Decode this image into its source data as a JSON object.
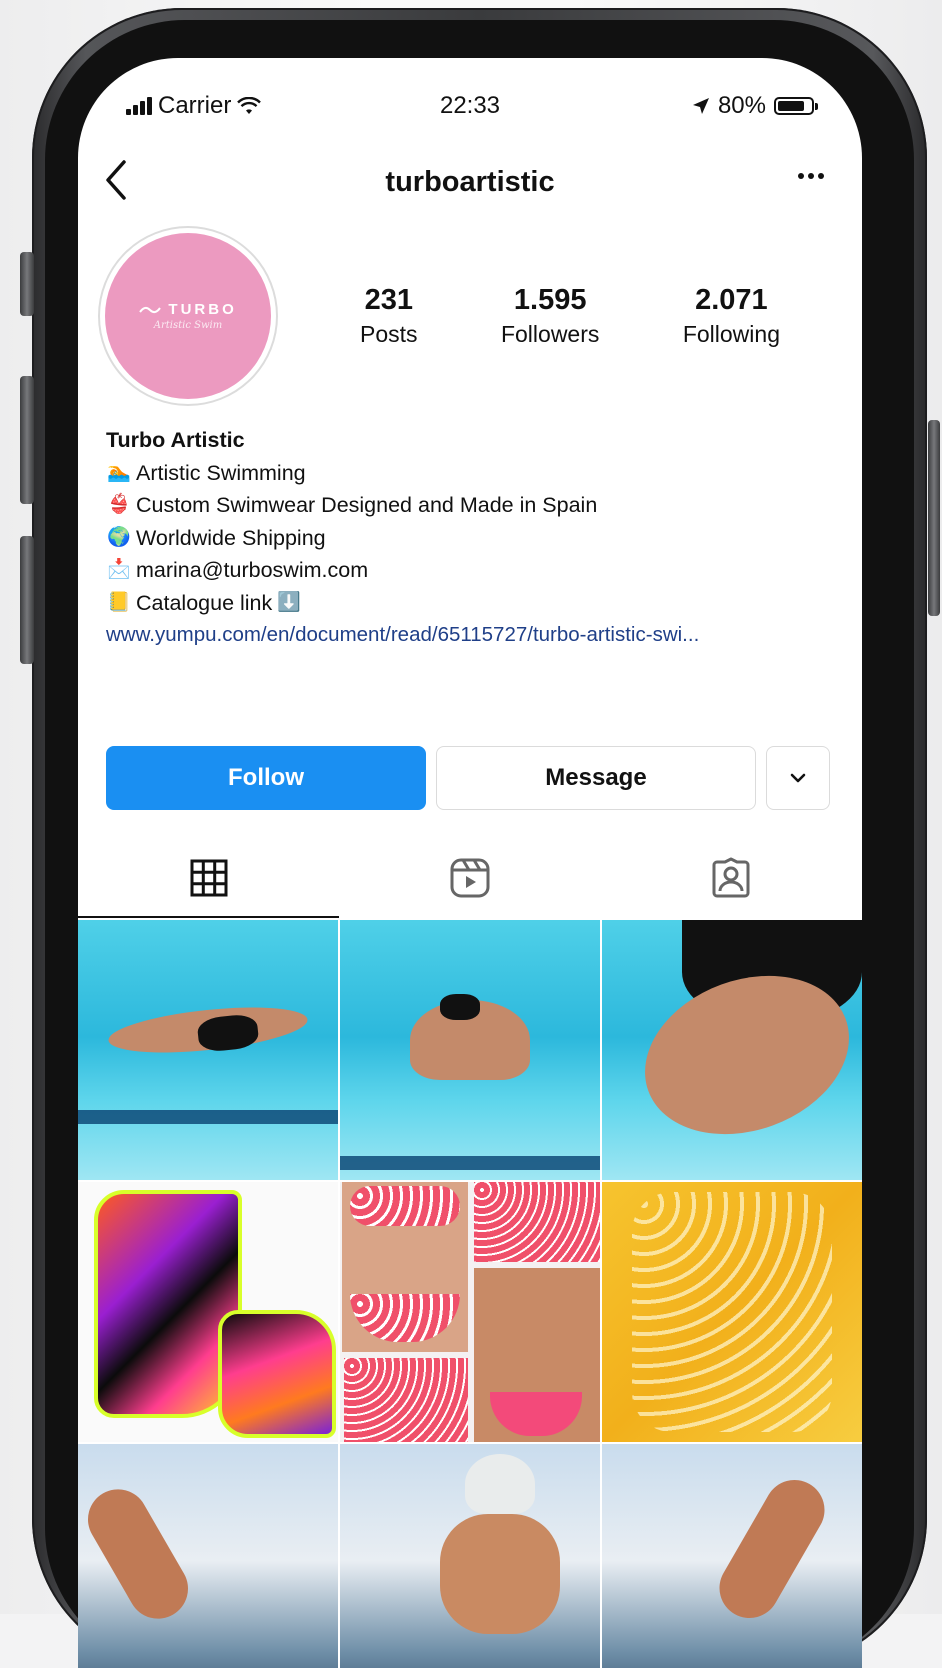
{
  "status_bar": {
    "carrier": "Carrier",
    "time": "22:33",
    "battery": "80%",
    "battery_level": 0.8
  },
  "nav": {
    "username": "turboartistic"
  },
  "avatar": {
    "brand_text": "TURBO",
    "script_text": "Artistic Swim"
  },
  "stats": [
    {
      "num": "231",
      "label": "Posts"
    },
    {
      "num": "1.595",
      "label": "Followers"
    },
    {
      "num": "2.071",
      "label": "Following"
    }
  ],
  "bio": {
    "name": "Turbo Artistic",
    "lines": [
      {
        "icon": "swimmer-icon",
        "text": "Artistic Swimming"
      },
      {
        "icon": "bikini-icon",
        "text": "Custom Swimwear Designed and Made in Spain"
      },
      {
        "icon": "globe-icon",
        "text": "Worldwide Shipping"
      },
      {
        "icon": "envelope-icon",
        "text": "marina@turboswim.com"
      },
      {
        "icon": "ledger-icon",
        "text": " Catalogue link"
      }
    ],
    "link": "www.yumpu.com/en/document/read/65115727/turbo-artistic-swi..."
  },
  "actions": {
    "follow": "Follow",
    "message": "Message"
  },
  "tabs": [
    {
      "icon": "grid-icon",
      "active": true
    },
    {
      "icon": "reels-icon",
      "active": false
    },
    {
      "icon": "tagged-icon",
      "active": false
    }
  ]
}
